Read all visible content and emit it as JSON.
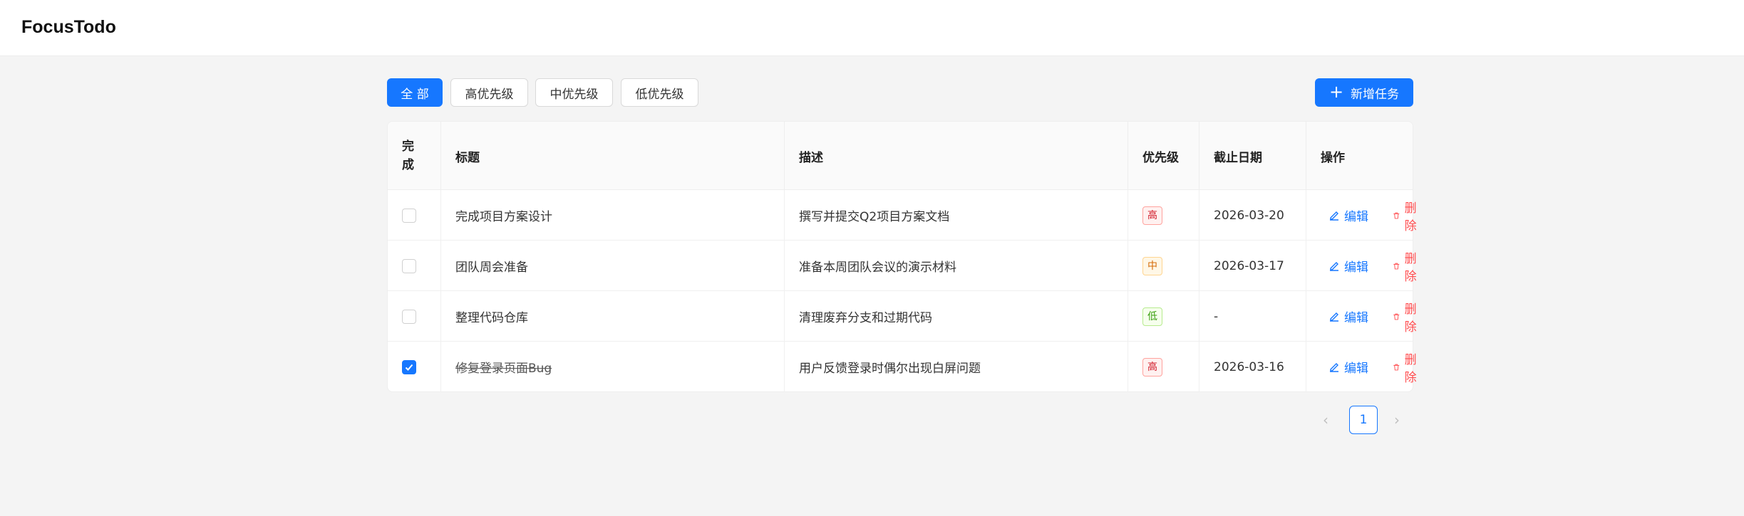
{
  "app": {
    "title": "FocusTodo"
  },
  "filters": [
    {
      "label": "全 部",
      "active": true
    },
    {
      "label": "高优先级",
      "active": false
    },
    {
      "label": "中优先级",
      "active": false
    },
    {
      "label": "低优先级",
      "active": false
    }
  ],
  "add_button": {
    "label": "新增任务"
  },
  "table": {
    "headers": {
      "done": "完成",
      "title": "标题",
      "desc": "描述",
      "priority": "优先级",
      "due": "截止日期",
      "actions": "操作"
    },
    "rows": [
      {
        "done": false,
        "title": "完成项目方案设计",
        "desc": "撰写并提交Q2项目方案文档",
        "priority": "高",
        "level": "high",
        "due": "2026-03-20"
      },
      {
        "done": false,
        "title": "团队周会准备",
        "desc": "准备本周团队会议的演示材料",
        "priority": "中",
        "level": "mid",
        "due": "2026-03-17"
      },
      {
        "done": false,
        "title": "整理代码仓库",
        "desc": "清理废弃分支和过期代码",
        "priority": "低",
        "level": "low",
        "due": "-"
      },
      {
        "done": true,
        "title": "修复登录页面Bug",
        "desc": "用户反馈登录时偶尔出现白屏问题",
        "priority": "高",
        "level": "high",
        "due": "2026-03-16"
      }
    ],
    "edit_label": "编辑",
    "delete_label": "删除"
  },
  "pagination": {
    "current": "1"
  },
  "colors": {
    "accent": "#1677ff",
    "danger": "#ff4d4f"
  }
}
